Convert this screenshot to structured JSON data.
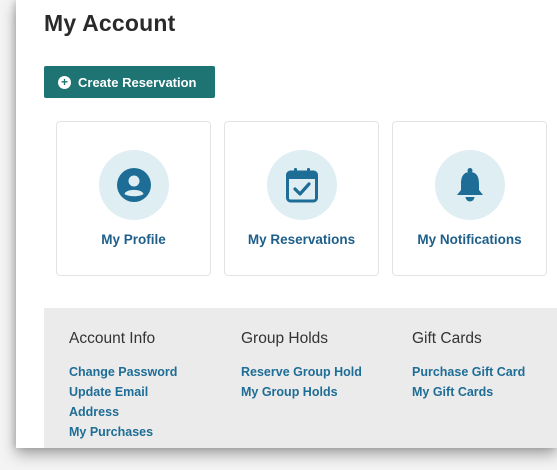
{
  "page": {
    "title": "My Account"
  },
  "actions": {
    "create_reservation_label": "Create Reservation"
  },
  "cards": [
    {
      "label": "My Profile",
      "icon": "user-icon"
    },
    {
      "label": "My Reservations",
      "icon": "calendar-check-icon"
    },
    {
      "label": "My Notifications",
      "icon": "bell-icon"
    }
  ],
  "footer": {
    "account_info": {
      "title": "Account Info",
      "links": [
        "Change Password",
        "Update Email Address",
        "My Purchases"
      ]
    },
    "group_holds": {
      "title": "Group Holds",
      "links": [
        "Reserve Group Hold",
        "My Group Holds"
      ]
    },
    "gift_cards": {
      "title": "Gift Cards",
      "links": [
        "Purchase Gift Card",
        "My Gift Cards"
      ]
    }
  },
  "colors": {
    "primary": "#1e7373",
    "link": "#1e6d96",
    "icon_bg": "#dfeef3"
  }
}
